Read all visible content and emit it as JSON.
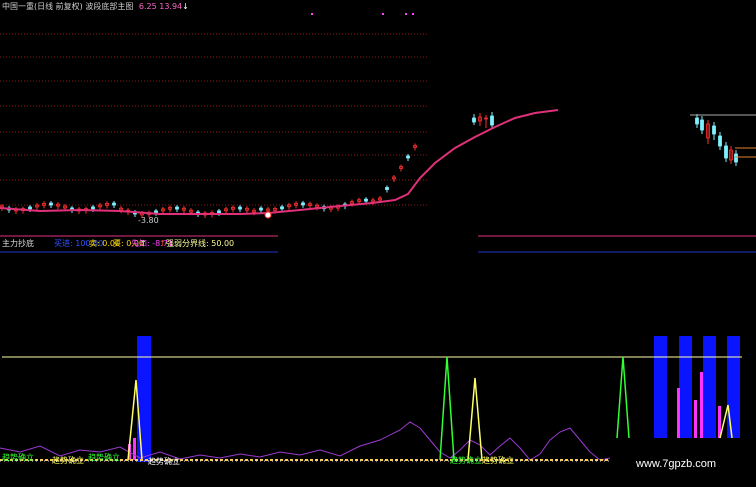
{
  "header": {
    "title": "中国一重(日线 前复权) 波段底部主图",
    "values": "6.25 13.94",
    "arrow": "↓",
    "title_color": "#cfcfcf",
    "value_color": "#ff66cc"
  },
  "main_panel": {
    "candle_label": "-3.80",
    "level_colors": {
      "dotted": "#8a1a1a",
      "ma": "#e0307a",
      "up": "#ff3030",
      "down": "#7ff0ff"
    }
  },
  "indicator_bar": {
    "name": "主力抄底",
    "items": [
      {
        "label": "买进: 100.00",
        "color": "#3355ff"
      },
      {
        "label": "卖: 0.00",
        "color": "#ffd700"
      },
      {
        "label": "买: 0.00",
        "color": "#ffd700"
      },
      {
        "label": "先知: -8.71",
        "color": "#ff44ff"
      },
      {
        "label": "强弱分界线: 50.00",
        "color": "#ffff99"
      }
    ],
    "arrow_up": "↑"
  },
  "signals": {
    "labels": [
      "趋势确立",
      "趋势确立",
      "趋势确立",
      "趋势确立",
      "趋势确立",
      "趋势确立"
    ]
  },
  "watermark": "www.7gpzb.com"
}
